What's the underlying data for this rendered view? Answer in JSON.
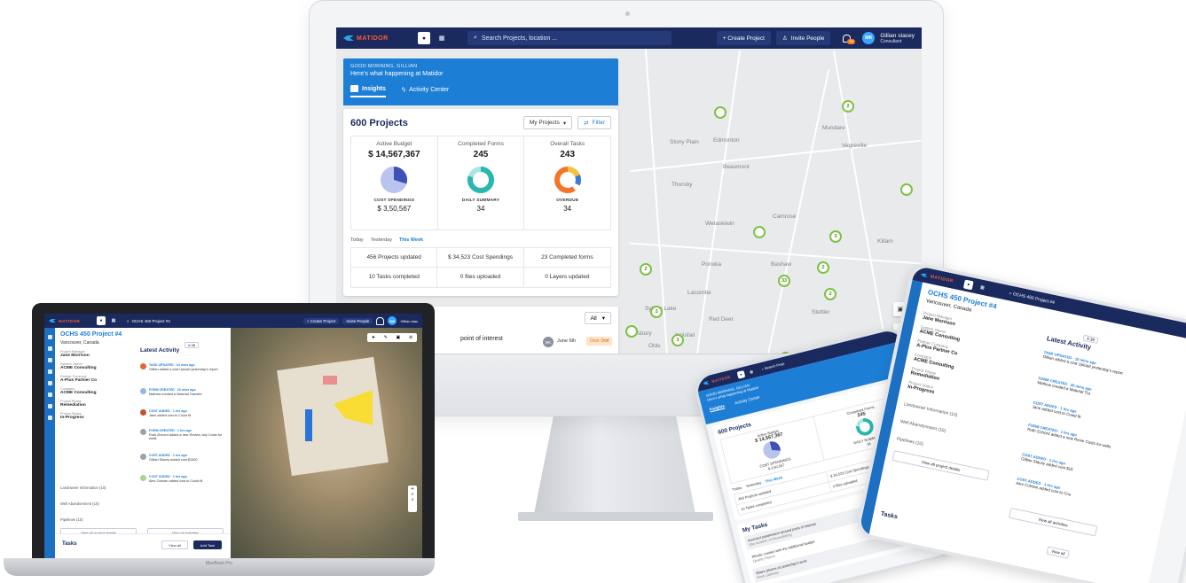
{
  "desktop": {
    "brand": "MATIDOR",
    "search_placeholder": "Search Projects, location ...",
    "create_project": "+ Create Project",
    "invite_people": "Invite People",
    "notif_count": "99",
    "user_initials": "MK",
    "user_name": "Gillian stacey",
    "user_role": "Consultant",
    "greeting": "GOOD MORNING, GILLIAN",
    "whats_happening": "Here's what happening at Matidor",
    "tabs": [
      "Insights",
      "Activity Center"
    ],
    "projects_title": "600 Projects",
    "filter_select": "My Projects",
    "filter_button": "Filter",
    "stats": [
      {
        "label": "Active Budget",
        "value": "$ 14,567,367",
        "sub_label": "COST SPENDINGS",
        "sub_value": "$ 3,50,567"
      },
      {
        "label": "Completed Forms",
        "value": "245",
        "sub_label": "DAILY SUMMARY",
        "sub_value": "34"
      },
      {
        "label": "Overall Tasks",
        "value": "243",
        "sub_label": "OVERDUE",
        "sub_value": "34"
      }
    ],
    "periods": [
      "Today",
      "Yesterday",
      "This Week"
    ],
    "summary": [
      "456 Projects updated",
      "$ 34,523 Cost Spendings",
      "23 Completed forms",
      "10 Tasks completed",
      "0 files uploaded",
      "0 Layers updated"
    ],
    "tasks_filter": "All",
    "task_text": "point of interest",
    "task_date": "June 6th",
    "task_status": "Over Due",
    "map_labels": [
      "Edmonton",
      "Stony Plain",
      "Beaumont",
      "Vegreville",
      "Mundare",
      "Thorsby",
      "Camrose",
      "Wetaskiwin",
      "Ponoka",
      "Bashaw",
      "Lacombe",
      "Red Deer",
      "Stettler",
      "Sylvan Lake",
      "Innisfail",
      "Olds",
      "Didsbury",
      "Killam"
    ],
    "pins": [
      "",
      "2",
      "",
      "",
      "3",
      "2",
      "33",
      "2",
      "3",
      "2",
      "",
      "3",
      "",
      "2",
      "2",
      "",
      "",
      ""
    ]
  },
  "laptop": {
    "search": "OCHS 450 Project #4",
    "create_project": "+ Create Project",
    "invite_people": "Invite People",
    "user_name": "Gillian stac",
    "project_title": "OCHS 450 Project #4",
    "location": "Vancouver, Canada",
    "fields": [
      {
        "label": "Project Manager",
        "value": "Jane Morrison"
      },
      {
        "label": "System Owner",
        "value": "ACME Consulting"
      },
      {
        "label": "Partner Company",
        "value": "A-Plus Partner Co"
      },
      {
        "label": "Company",
        "value": "ACME Consulting"
      },
      {
        "label": "Project Phase",
        "value": "Remediation"
      },
      {
        "label": "Project Status",
        "value": "In-Progress"
      }
    ],
    "links": [
      "Landowner Information (10)",
      "Well Abandonment (10)",
      "Pipelines (10)"
    ],
    "view_project": "View all project details",
    "activity_title": "Latest Activity",
    "activities": [
      {
        "head": "TASK UPDATED · 10 mins ago",
        "text": "Gillian added a cost Upload yesterday's report",
        "color": "#e0663a"
      },
      {
        "head": "FORM CREATED · 20 mins ago",
        "text": "Mathew created a Material Transfer",
        "color": "#8fb8e8"
      },
      {
        "head": "COST ADDED · 1 hrs ago",
        "text": "Jane added cost to Could fit",
        "color": "#c0552a"
      },
      {
        "head": "FORM CREATED · 1 hrs ago",
        "text": "Ruth Zichord added a new Review July Costs for wells",
        "color": "#9aa2b0"
      },
      {
        "head": "COST ADDED · 1 hrs ago",
        "text": "Gillian Stacey added cost $1500",
        "color": "#9aa2b0"
      },
      {
        "head": "COST ADDED · 1 hrs ago",
        "text": "Alex Colman added cost to Could fit",
        "color": "#a8d490"
      }
    ],
    "view_activities": "View all activities",
    "tasks_title": "Tasks",
    "view_all": "View all",
    "add_task": "Add Task",
    "badge": "A 38",
    "base_label": "MacBook Pro"
  },
  "phone": {
    "brand": "MATIDOR",
    "search": "Search Proje",
    "greeting": "GOOD MORNING, GILLIAN",
    "whats": "Here's what happening at Matidor",
    "tabs": [
      "Insights",
      "Activity Center"
    ],
    "projects_title": "600 Projects",
    "active_budget": "Active Budget",
    "budget_value": "$ 14,567,367",
    "completed_forms": "Completed Forms",
    "forms_value": "245",
    "cost_spendings": "COST SPENDINGS",
    "cost_value": "$ 3,50,567",
    "daily_summary": "DAILY SUMMARY",
    "daily_value": "34",
    "periods": [
      "Today",
      "Yesterday",
      "This Week"
    ],
    "summary": [
      "456 Projects updated",
      "$ 34,523 Cost Spendings",
      "10 Tasks completed",
      "0 files uploaded"
    ],
    "my_tasks": "My Tasks",
    "tasks": [
      {
        "title": "Incorrect parameters around point of interest",
        "sub": "Site location of Remediating"
      },
      {
        "title": "Please contact with the Additional budget",
        "sub": "Quality Report"
      },
      {
        "title": "Share photos of yesterday's work",
        "sub": "Work pathway"
      }
    ]
  },
  "tablet": {
    "brand": "MATIDOR",
    "search": "OCHS 450 Project #4",
    "project_title": "OCHS 450 Project #4",
    "location": "Vancouver, Canada",
    "badge": "A 38",
    "fields": [
      {
        "label": "Project Manager",
        "value": "Jane Morrison"
      },
      {
        "label": "System Owner",
        "value": "ACME Consulting"
      },
      {
        "label": "Partner Company",
        "value": "A-Plus Partner Co"
      },
      {
        "label": "Company",
        "value": "ACME Consulting"
      },
      {
        "label": "Project Phase",
        "value": "Remediation"
      },
      {
        "label": "Project Status",
        "value": "In-Progress"
      }
    ],
    "links": [
      "Landowner Information (10)",
      "Well Abandonment (10)",
      "Pipelines (10)"
    ],
    "view_project": "View all project details",
    "activity_title": "Latest Activity",
    "activities": [
      {
        "head": "TASK UPDATED · 10 mins ago",
        "text": "Gillian added a cost Upload yesterday's report"
      },
      {
        "head": "FORM CREATED · 20 mins ago",
        "text": "Mathew created a Material Tra"
      },
      {
        "head": "COST ADDED · 1 hrs ago",
        "text": "Jane added cost to Could fit"
      },
      {
        "head": "FORM CREATED · 1 hrs ago",
        "text": "Ruth Zichord added a new Revie Costs for wells"
      },
      {
        "head": "COST ADDED · 1 hrs ago",
        "text": "Gillian Stacey added cost $15"
      },
      {
        "head": "COST ADDED · 1 hrs ago",
        "text": "Alex Colman added cost to Cou"
      }
    ],
    "view_activities": "View all activities",
    "tasks_title": "Tasks",
    "view_all": "View all"
  },
  "colors": {
    "navy": "#1a2a5e",
    "brand_blue": "#1d7ed6",
    "pin_green": "#7cc243",
    "overdue_orange": "#e07a1a"
  },
  "icons": [
    "location-pin-icon",
    "grid-icon",
    "search-icon",
    "bell-icon",
    "person-icon",
    "chart-icon",
    "bolt-icon",
    "filter-icon",
    "chevron-down-icon",
    "camera-icon",
    "layers-icon",
    "more-icon"
  ]
}
